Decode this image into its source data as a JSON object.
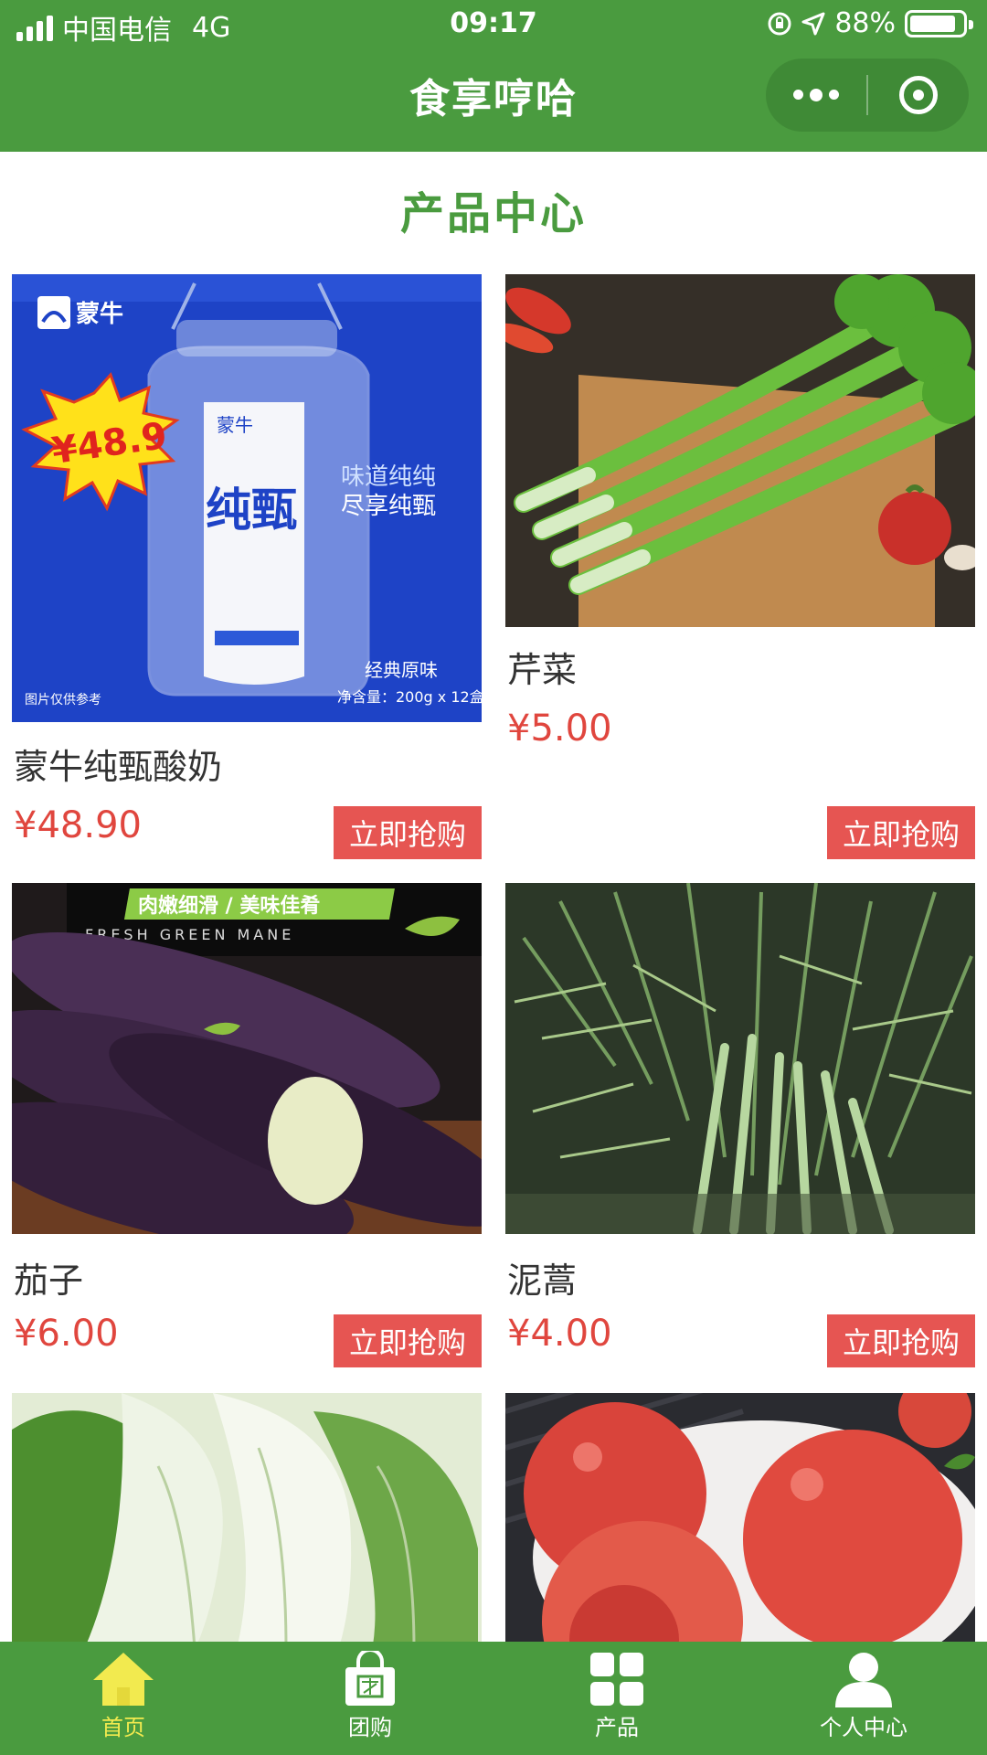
{
  "status_bar": {
    "carrier": "中国电信",
    "network": "4G",
    "time": "09:17",
    "battery": "88%",
    "battery_fraction": 0.88
  },
  "header": {
    "title": "食享哼哈",
    "more_icon": "more-dots-icon",
    "close_icon": "target-circle-icon"
  },
  "section": {
    "title": "产品中心"
  },
  "products": [
    {
      "name": "蒙牛纯甄酸奶",
      "price": "¥48.90",
      "buy": "立即抢购",
      "image_text": {
        "brand": "蒙牛",
        "burst": "¥48.9",
        "product": "纯甄",
        "slogan1": "味道纯纯",
        "slogan2": "尽享纯甄",
        "flavor": "经典原味",
        "spec": "净含量：200g x 12盒",
        "note": "图片仅供参考"
      }
    },
    {
      "name": "芹菜",
      "price": "¥5.00",
      "buy": "立即抢购"
    },
    {
      "name": "茄子",
      "price": "¥6.00",
      "buy": "立即抢购",
      "image_text": {
        "banner": "肉嫩细滑 / 美味佳肴",
        "sub": "FRESH  GREEN  MANE"
      }
    },
    {
      "name": "泥蒿",
      "price": "¥4.00",
      "buy": "立即抢购"
    },
    {
      "name": "",
      "price": "",
      "buy": ""
    },
    {
      "name": "",
      "price": "",
      "buy": ""
    }
  ],
  "tabbar": {
    "tabs": [
      {
        "label": "首页",
        "icon": "home-icon",
        "active": true
      },
      {
        "label": "团购",
        "icon": "shopping-bag-icon",
        "active": false
      },
      {
        "label": "产品",
        "icon": "grid-icon",
        "active": false
      },
      {
        "label": "个人中心",
        "icon": "user-icon",
        "active": false
      }
    ],
    "colors": {
      "active": "#f2ea4f",
      "inactive": "#ffffff",
      "background": "#4a9b3f"
    }
  },
  "colors": {
    "brand_green": "#4a9b3f",
    "price_red": "#e0463e",
    "buy_button": "#e65552"
  }
}
